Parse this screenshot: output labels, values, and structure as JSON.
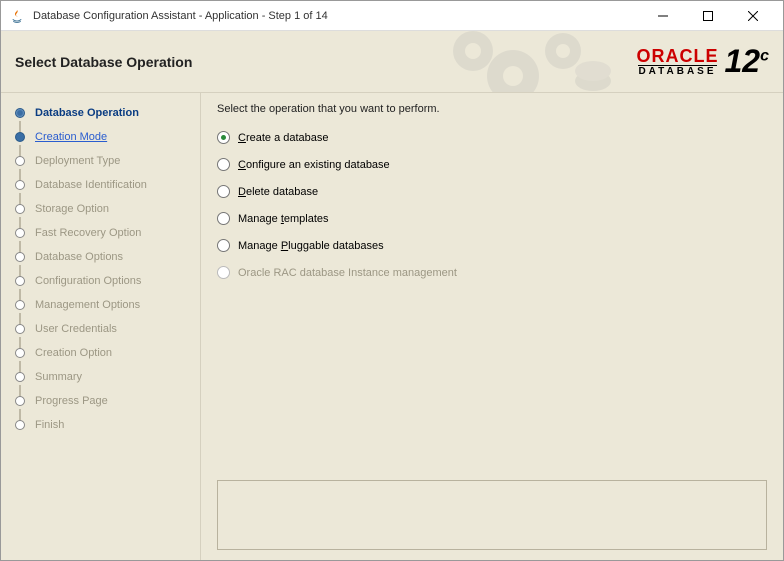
{
  "window": {
    "title": "Database Configuration Assistant - Application - Step 1 of 14"
  },
  "header": {
    "title": "Select Database Operation",
    "brand_top": "ORACLE",
    "brand_bottom": "DATABASE",
    "brand_version": "12",
    "brand_suffix": "c"
  },
  "sidebar": {
    "steps": [
      {
        "label": "Database Operation",
        "state": "active"
      },
      {
        "label": "Creation Mode",
        "state": "enabled"
      },
      {
        "label": "Deployment Type",
        "state": "disabled"
      },
      {
        "label": "Database Identification",
        "state": "disabled"
      },
      {
        "label": "Storage Option",
        "state": "disabled"
      },
      {
        "label": "Fast Recovery Option",
        "state": "disabled"
      },
      {
        "label": "Database Options",
        "state": "disabled"
      },
      {
        "label": "Configuration Options",
        "state": "disabled"
      },
      {
        "label": "Management Options",
        "state": "disabled"
      },
      {
        "label": "User Credentials",
        "state": "disabled"
      },
      {
        "label": "Creation Option",
        "state": "disabled"
      },
      {
        "label": "Summary",
        "state": "disabled"
      },
      {
        "label": "Progress Page",
        "state": "disabled"
      },
      {
        "label": "Finish",
        "state": "disabled"
      }
    ]
  },
  "main": {
    "instruction": "Select the operation that you want to perform.",
    "options": [
      {
        "mnemonic": "C",
        "rest": "reate a database",
        "selected": true,
        "enabled": true
      },
      {
        "mnemonic": "C",
        "pre": "",
        "rest": "onfigure an existing database",
        "selected": false,
        "enabled": true
      },
      {
        "mnemonic": "D",
        "rest": "elete database",
        "selected": false,
        "enabled": true
      },
      {
        "mnemonic": "t",
        "pre": "Manage ",
        "rest": "emplates",
        "selected": false,
        "enabled": true
      },
      {
        "mnemonic": "P",
        "pre": "Manage ",
        "rest": "luggable databases",
        "selected": false,
        "enabled": true
      },
      {
        "mnemonic": "",
        "pre": "Oracle RAC database Instance management",
        "rest": "",
        "selected": false,
        "enabled": false
      }
    ]
  }
}
